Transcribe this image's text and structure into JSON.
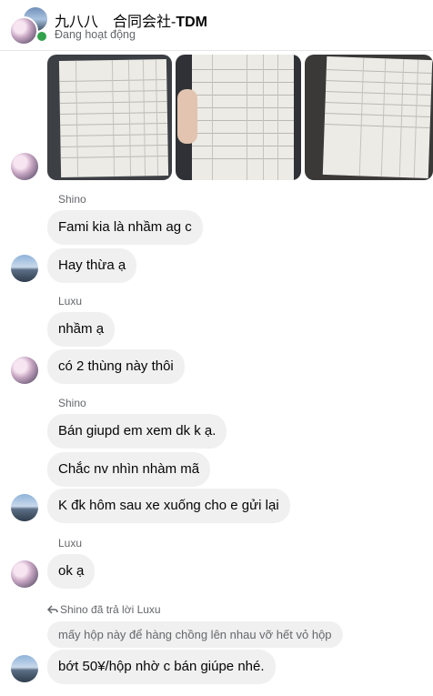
{
  "header": {
    "name_prefix": "九八八　合同会社-",
    "name_bold": "TDM",
    "status": "Đang hoạt động"
  },
  "messages": [
    {
      "sender": "Shino",
      "text": "Fami kia là nhầm ag c"
    },
    {
      "text": "Hay thừa ạ"
    },
    {
      "sender": "Luxu",
      "text": "nhầm ạ"
    },
    {
      "text": "có 2 thùng này thôi"
    },
    {
      "sender": "Shino",
      "text": "Bán giupd em xem dk k ạ."
    },
    {
      "text": "Chắc nv nhìn nhàm mã"
    },
    {
      "text": "K đk hôm sau xe xuống cho e gửi lại"
    },
    {
      "sender": "Luxu",
      "text": "ok ạ"
    }
  ],
  "reply": {
    "label": "Shino đã trả lời Luxu",
    "quoted": "mấy hộp này để hàng chồng lên nhau vỡ hết vỏ hộp",
    "text": "bớt 50¥/hộp nhờ c bán giúpe nhé."
  },
  "icons": [
    "reply-arrow-icon"
  ],
  "colors": {
    "online": "#31a24c",
    "bubble": "#f0f0f0",
    "meta": "#65676b"
  }
}
